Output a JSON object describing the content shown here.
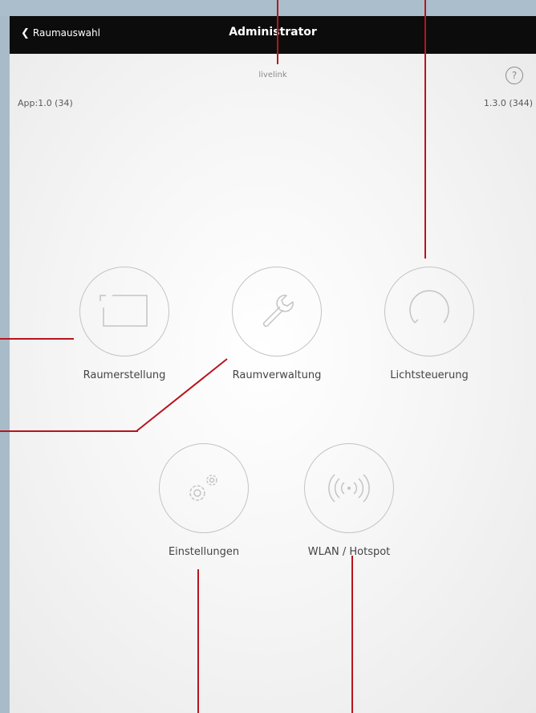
{
  "nav": {
    "back_label": "Raumauswahl",
    "title": "Administrator"
  },
  "subtitle": "livelink",
  "help_icon": "question-mark-icon",
  "versions": {
    "app": "App:1.0 (34)",
    "firmware": "1.3.0 (344)"
  },
  "menu": [
    {
      "label": "Raumerstellung",
      "icon": "room-frame-icon"
    },
    {
      "label": "Raumverwaltung",
      "icon": "wrench-icon"
    },
    {
      "label": "Lichtsteuerung",
      "icon": "dial-icon"
    },
    {
      "label": "Einstellungen",
      "icon": "gears-icon"
    },
    {
      "label": "WLAN / Hotspot",
      "icon": "wifi-signal-icon"
    }
  ],
  "colors": {
    "callout": "#b8141e",
    "navbar": "#0c0c0c",
    "frame": "#a9bdc9"
  }
}
